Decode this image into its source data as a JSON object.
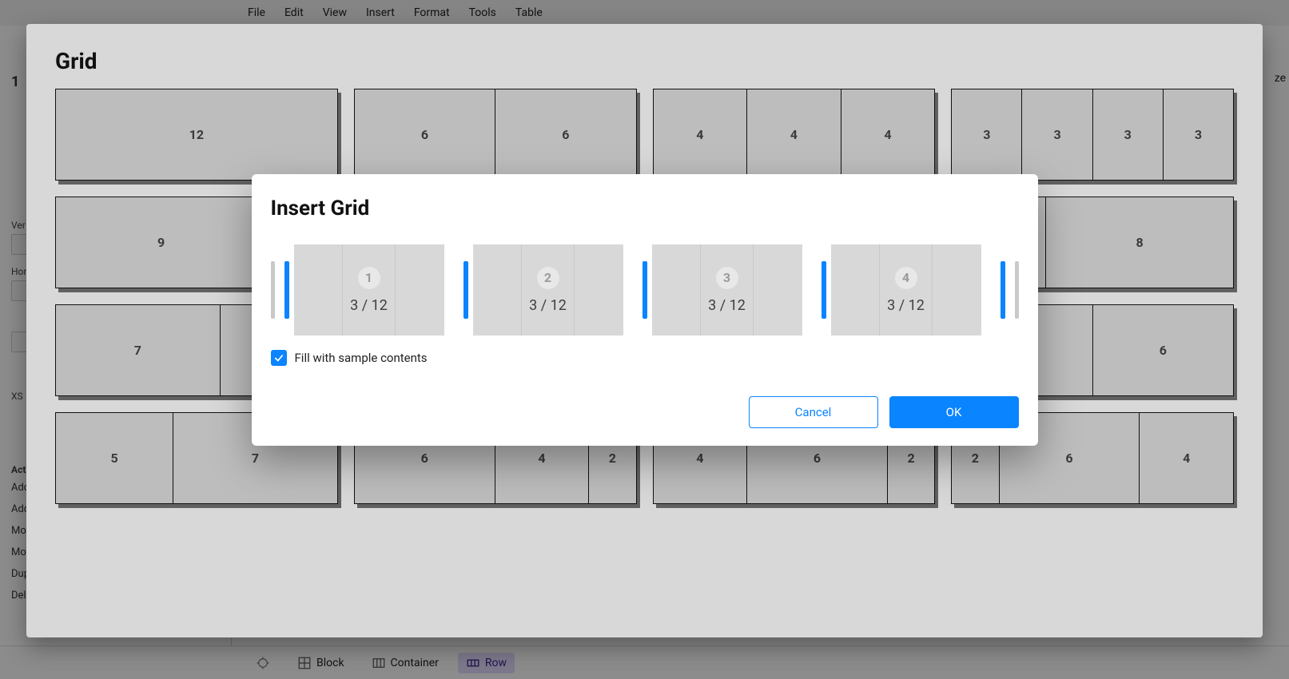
{
  "menubar": [
    "File",
    "Edit",
    "View",
    "Insert",
    "Format",
    "Tools",
    "Table"
  ],
  "sidebar": {
    "plus": "+",
    "heading": "1",
    "labels": {
      "vert": "Ver",
      "horiz": "Hor",
      "xs": "XS"
    },
    "actions_header": "Act",
    "actions": [
      "Add",
      "Add",
      "Mo",
      "Mo",
      "Dup",
      "Delete Row"
    ]
  },
  "right_peek": "ze",
  "breadcrumb": {
    "block": "Block",
    "container": "Container",
    "row": "Row"
  },
  "bg_dialog": {
    "title": "Grid",
    "rows": [
      [
        [
          12
        ],
        [
          6,
          6
        ],
        [
          4,
          4,
          4
        ],
        [
          3,
          3,
          3,
          3
        ]
      ],
      [
        [
          9
        ],
        [],
        [],
        [
          8
        ]
      ],
      [
        [
          7
        ],
        [],
        [],
        [
          6
        ]
      ],
      [
        [
          5,
          7
        ],
        [
          6,
          4,
          2
        ],
        [
          4,
          6,
          2
        ],
        [
          2,
          6,
          4
        ]
      ]
    ]
  },
  "modal": {
    "title": "Insert Grid",
    "columns": [
      {
        "num": "1",
        "ratio": "3 / 12"
      },
      {
        "num": "2",
        "ratio": "3 / 12"
      },
      {
        "num": "3",
        "ratio": "3 / 12"
      },
      {
        "num": "4",
        "ratio": "3 / 12"
      }
    ],
    "checkbox_label": "Fill with sample contents",
    "checkbox_checked": true,
    "cancel": "Cancel",
    "ok": "OK"
  }
}
